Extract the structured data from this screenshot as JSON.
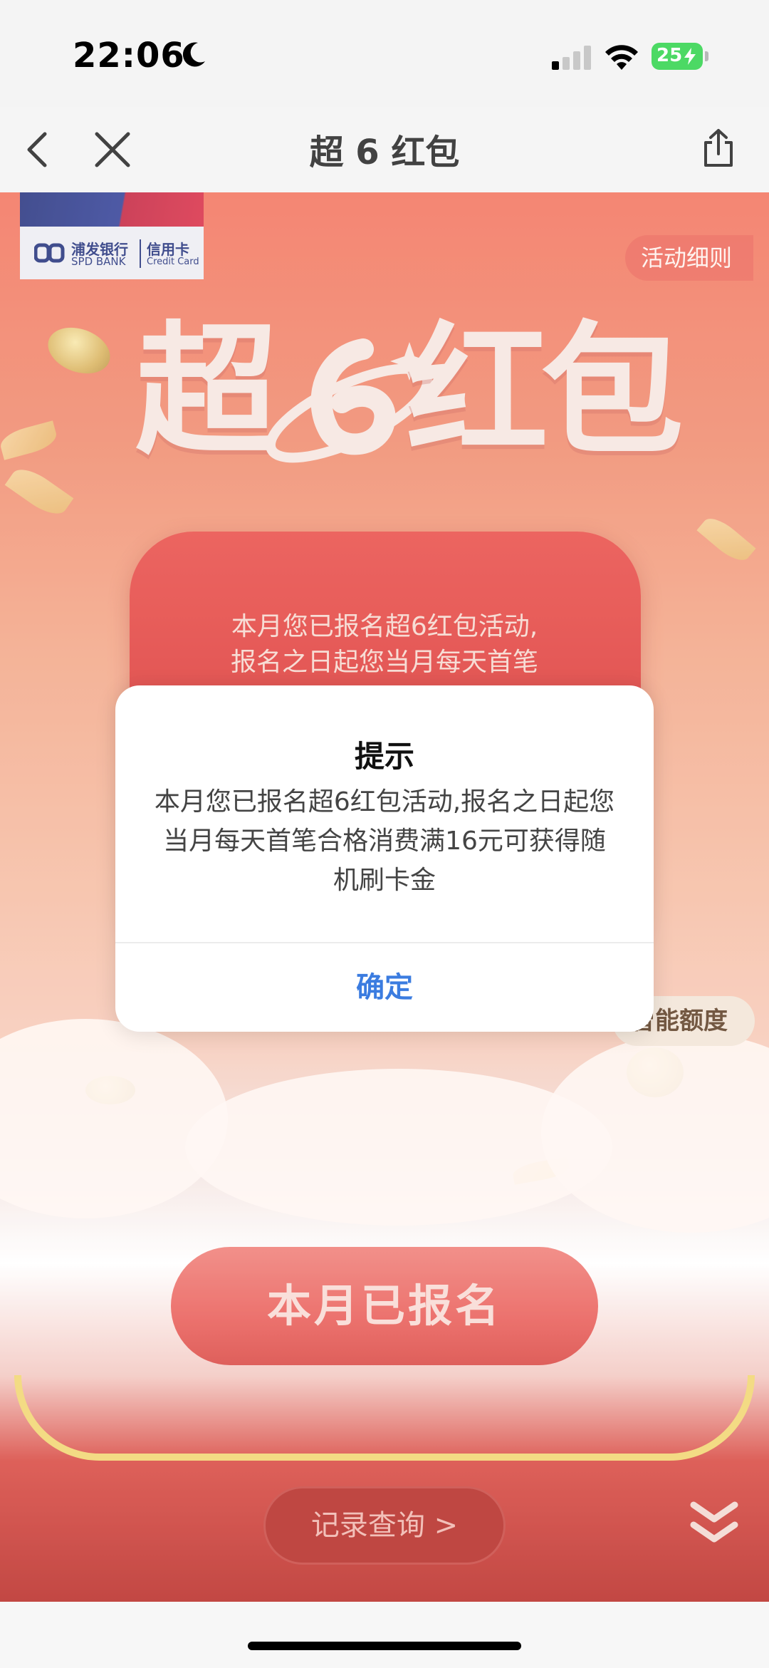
{
  "status_bar": {
    "time": "22:06",
    "battery": "25",
    "icons": [
      "moon-icon",
      "signal-icon",
      "wifi-icon",
      "battery-charging-icon"
    ]
  },
  "nav": {
    "title": "超 6 红包",
    "back_icon": "chevron-left-icon",
    "close_icon": "close-icon",
    "share_icon": "share-icon"
  },
  "page": {
    "bank_name_cn": "浦发银行",
    "bank_name_en": "SPD BANK",
    "card_cn": "信用卡",
    "card_en": "Credit Card",
    "rules_link": "活动细则",
    "hero_chars": [
      "超",
      "红",
      "包"
    ],
    "card_text_line1": "本月您已报名超6红包活动,",
    "card_text_line2": "报名之日起您当月每天首笔",
    "badge": "智能额度",
    "signup_button": "本月已报名",
    "records_button": "记录查询 >",
    "scroll_icon": "double-chevron-down-icon",
    "colors": {
      "primary_red": "#d8302f",
      "gold": "#f1d56f",
      "link_blue": "#3b7ce0"
    }
  },
  "dialog": {
    "title": "提示",
    "message": "本月您已报名超6红包活动,报名之日起您当月每天首笔合格消费满16元可获得随机刷卡金",
    "confirm": "确定"
  }
}
